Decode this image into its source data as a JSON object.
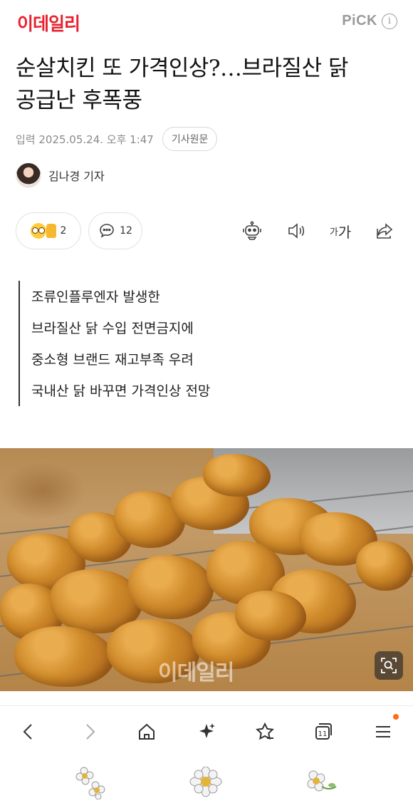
{
  "header": {
    "logo": "이데일리",
    "pick_label": "PiCK",
    "info_glyph": "i"
  },
  "article": {
    "headline_line1": "순살치킨 또 가격인상?…브라질산 닭",
    "headline_line2": "공급난 후폭풍",
    "date": "입력 2025.05.24. 오후 1:47",
    "origin_button": "기사원문",
    "reporter": "김나경 기자",
    "reaction_count": "2",
    "comment_count": "12",
    "font_tool_small": "가",
    "font_tool_big": "가",
    "summary": [
      "조류인플루엔자 발생한",
      "브라질산 닭 수입 전면금지에",
      "중소형 브랜드 재고부족 우려",
      "국내산 닭 바꾸면 가격인상 전망"
    ],
    "photo_watermark": "이데일리"
  },
  "nav": {
    "tabs_count": "11"
  },
  "colors": {
    "brand_red": "#e8212e",
    "notification_dot": "#ff6a1a"
  },
  "icons": [
    "info-icon",
    "robot-icon",
    "speaker-icon",
    "share-icon",
    "comment-icon",
    "zoom-icon",
    "back-icon",
    "forward-icon",
    "home-icon",
    "sparkle-icon",
    "star-bookmark-icon",
    "tabs-icon",
    "menu-icon"
  ]
}
